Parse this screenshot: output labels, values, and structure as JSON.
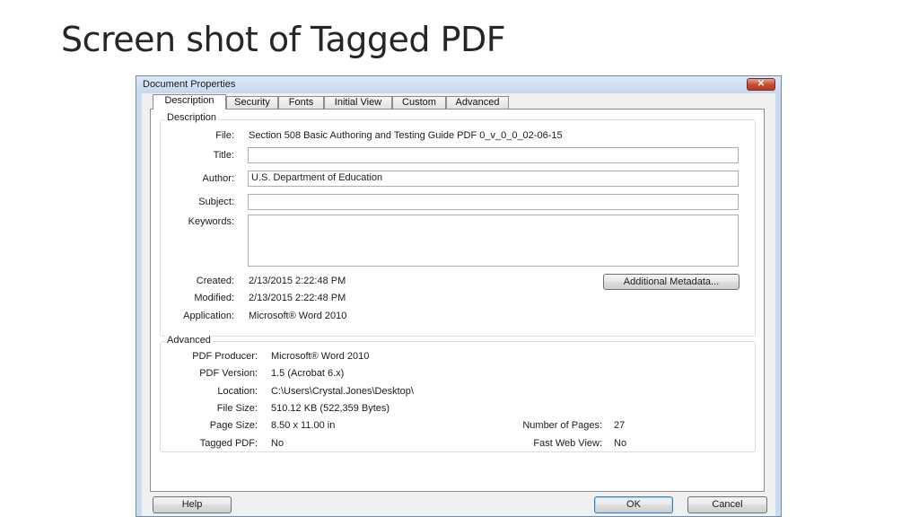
{
  "slide": {
    "title": "Screen shot of Tagged PDF"
  },
  "dialog": {
    "title": "Document Properties",
    "close_glyph": "✕",
    "tabs": [
      "Description",
      "Security",
      "Fonts",
      "Initial View",
      "Custom",
      "Advanced"
    ],
    "description": {
      "legend": "Description",
      "file_label": "File:",
      "file_value": "Section 508 Basic Authoring and Testing Guide PDF 0_v_0_0_02-06-15",
      "title_label": "Title:",
      "title_value": "",
      "author_label": "Author:",
      "author_value": "U.S. Department of Education",
      "subject_label": "Subject:",
      "subject_value": "",
      "keywords_label": "Keywords:",
      "keywords_value": "",
      "created_label": "Created:",
      "created_value": "2/13/2015 2:22:48 PM",
      "modified_label": "Modified:",
      "modified_value": "2/13/2015 2:22:48 PM",
      "application_label": "Application:",
      "application_value": "Microsoft® Word 2010",
      "metadata_button": "Additional Metadata..."
    },
    "advanced": {
      "legend": "Advanced",
      "producer_label": "PDF Producer:",
      "producer_value": "Microsoft® Word 2010",
      "version_label": "PDF Version:",
      "version_value": "1.5 (Acrobat 6.x)",
      "location_label": "Location:",
      "location_value": "C:\\Users\\Crystal.Jones\\Desktop\\",
      "filesize_label": "File Size:",
      "filesize_value": "510.12 KB (522,359 Bytes)",
      "pagesize_label": "Page Size:",
      "pagesize_value": "8.50 x 11.00 in",
      "numpages_label": "Number of Pages:",
      "numpages_value": "27",
      "tagged_label": "Tagged PDF:",
      "tagged_value": "No",
      "fastweb_label": "Fast Web View:",
      "fastweb_value": "No"
    },
    "buttons": {
      "help": "Help",
      "ok": "OK",
      "cancel": "Cancel"
    },
    "highlight_color": "#e01928"
  }
}
